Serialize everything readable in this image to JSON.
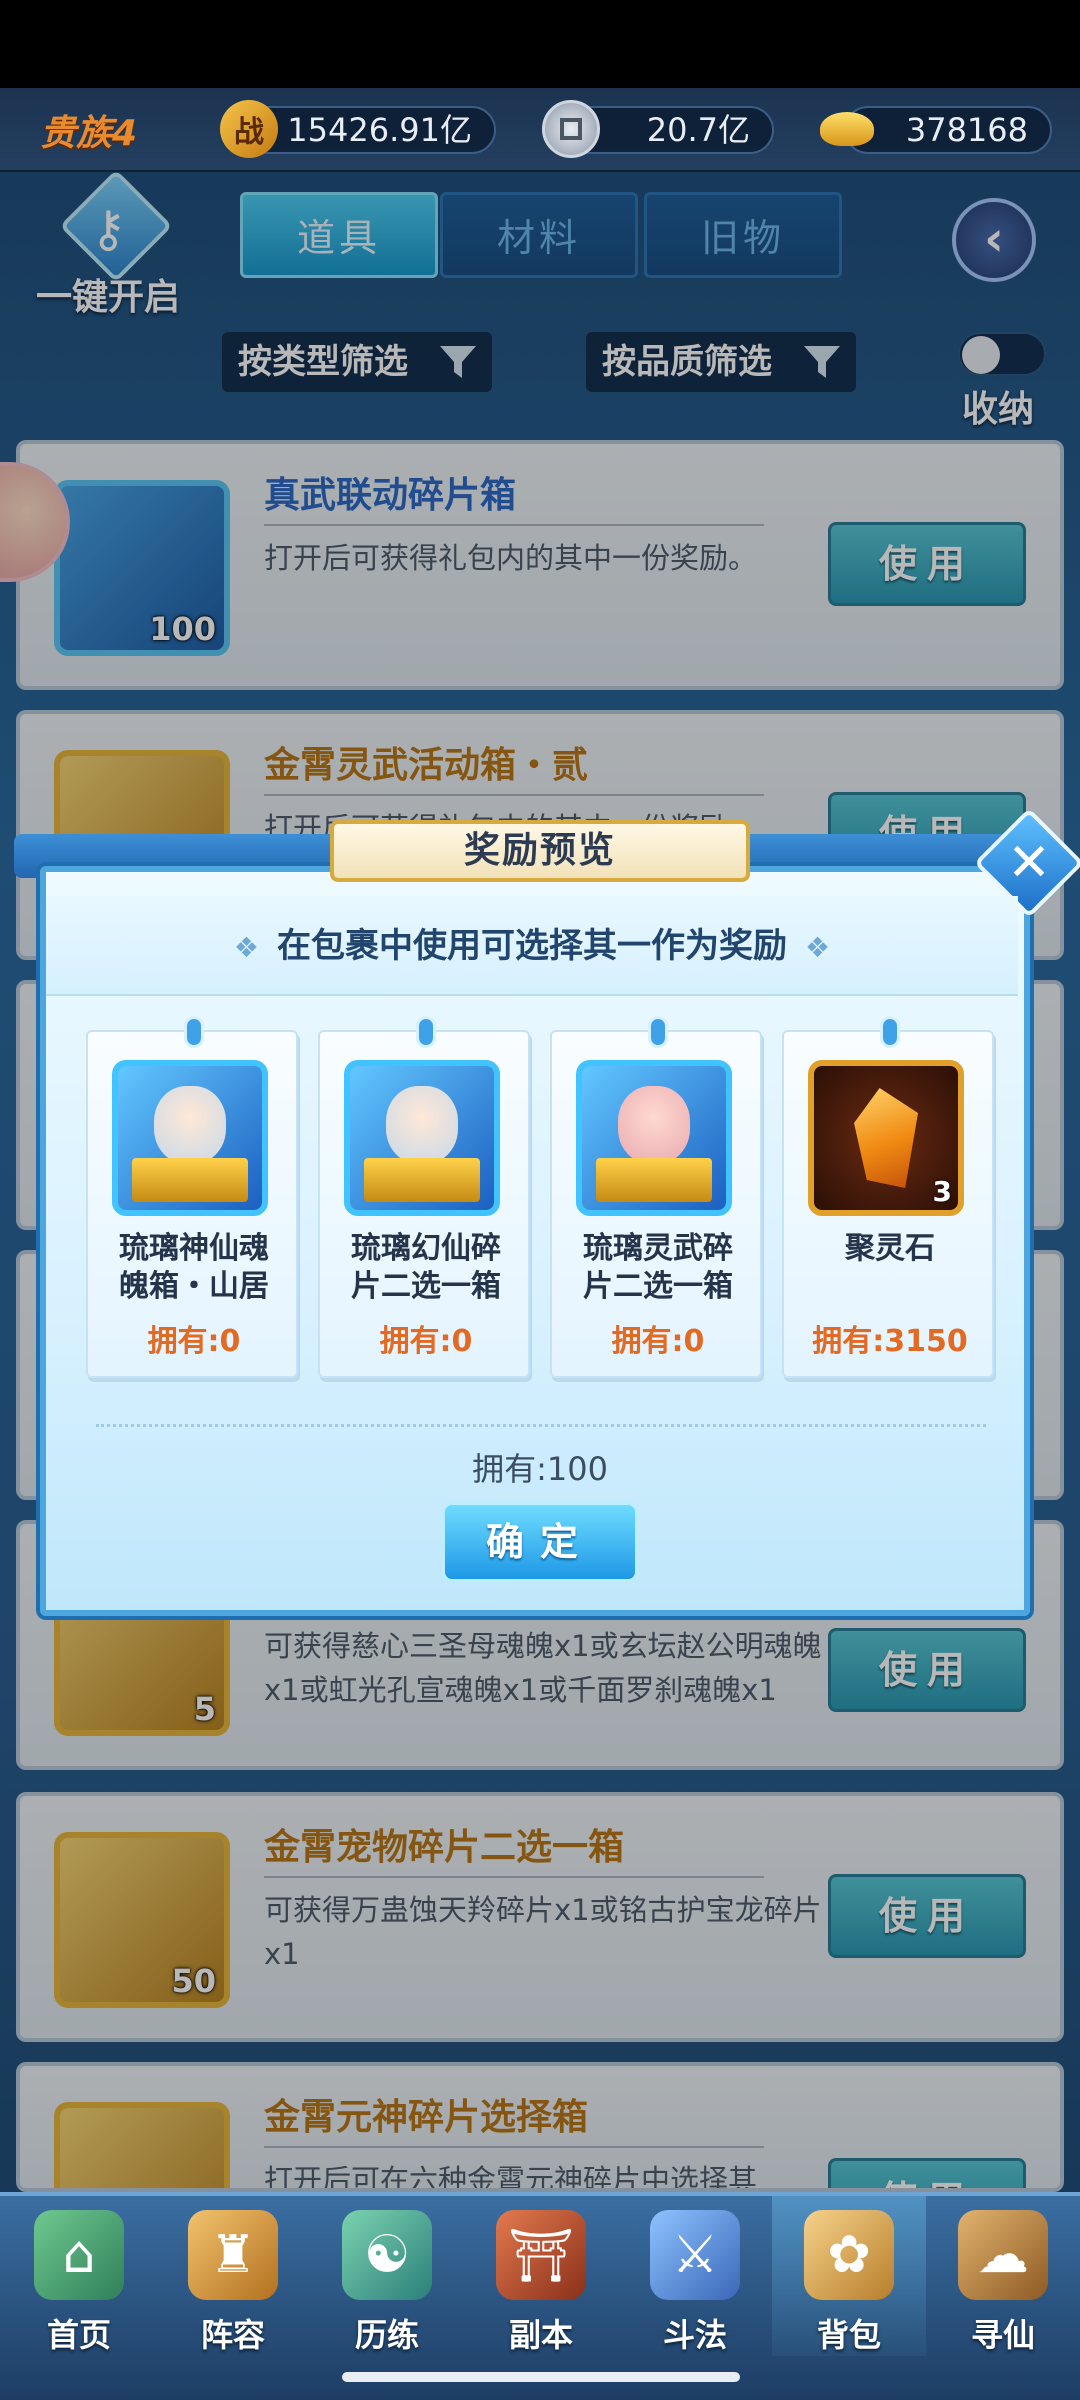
{
  "top_bar": {
    "vip": "贵族4",
    "power_icon": "战",
    "power": "15426.91亿",
    "coin": "20.7亿",
    "ingot": "378168"
  },
  "controls": {
    "open_all": "一键开启",
    "tabs": [
      {
        "label": "道具",
        "active": true
      },
      {
        "label": "材料",
        "active": false
      },
      {
        "label": "旧物",
        "active": false
      }
    ],
    "filter_type": "按类型筛选",
    "filter_quality": "按品质筛选",
    "collapse": "收纳"
  },
  "items": [
    {
      "title": "真武联动碎片箱",
      "desc": "打开后可获得礼包内的其中一份奖励。",
      "count": "100",
      "use": "使用"
    },
    {
      "title": "金霄灵武活动箱・贰",
      "desc": "打开后可获得礼包内的其中一份奖励。",
      "count": "",
      "use": "使用"
    },
    {
      "title": "",
      "desc": "可获得慈心三圣母魂魄x1或玄坛赵公明魂魄x1或虹光孔宣魂魄x1或千面罗刹魂魄x1",
      "count": "5",
      "use": "使用"
    },
    {
      "title": "金霄宠物碎片二选一箱",
      "desc": "可获得万蛊蚀天羚碎片x1或铭古护宝龙碎片x1",
      "count": "50",
      "use": "使用"
    },
    {
      "title": "金霄元神碎片选择箱",
      "desc": "打开后可在六种金霄元神碎片中选择其",
      "count": "",
      "use": "使用"
    }
  ],
  "dialog": {
    "title": "奖励预览",
    "subtitle": "在包裹中使用可选择其一作为奖励",
    "rewards": [
      {
        "name_line1": "琉璃神仙魂",
        "name_line2": "魄箱・山居",
        "owned": "拥有:0"
      },
      {
        "name_line1": "琉璃幻仙碎",
        "name_line2": "片二选一箱",
        "owned": "拥有:0"
      },
      {
        "name_line1": "琉璃灵武碎",
        "name_line2": "片二选一箱",
        "owned": "拥有:0"
      },
      {
        "name_line1": "聚灵石",
        "name_line2": "",
        "owned": "拥有:3150",
        "qty": "3"
      }
    ],
    "owned_total": "拥有:100",
    "confirm": "确定"
  },
  "nav": [
    {
      "label": "首页",
      "icon": "home-icon",
      "active": false
    },
    {
      "label": "阵容",
      "icon": "lineup-icon",
      "active": false
    },
    {
      "label": "历练",
      "icon": "training-icon",
      "active": false
    },
    {
      "label": "副本",
      "icon": "dungeon-icon",
      "active": false
    },
    {
      "label": "斗法",
      "icon": "battle-icon",
      "active": false
    },
    {
      "label": "背包",
      "icon": "backpack-icon",
      "active": true
    },
    {
      "label": "寻仙",
      "icon": "seek-immortal-icon",
      "active": false
    }
  ]
}
